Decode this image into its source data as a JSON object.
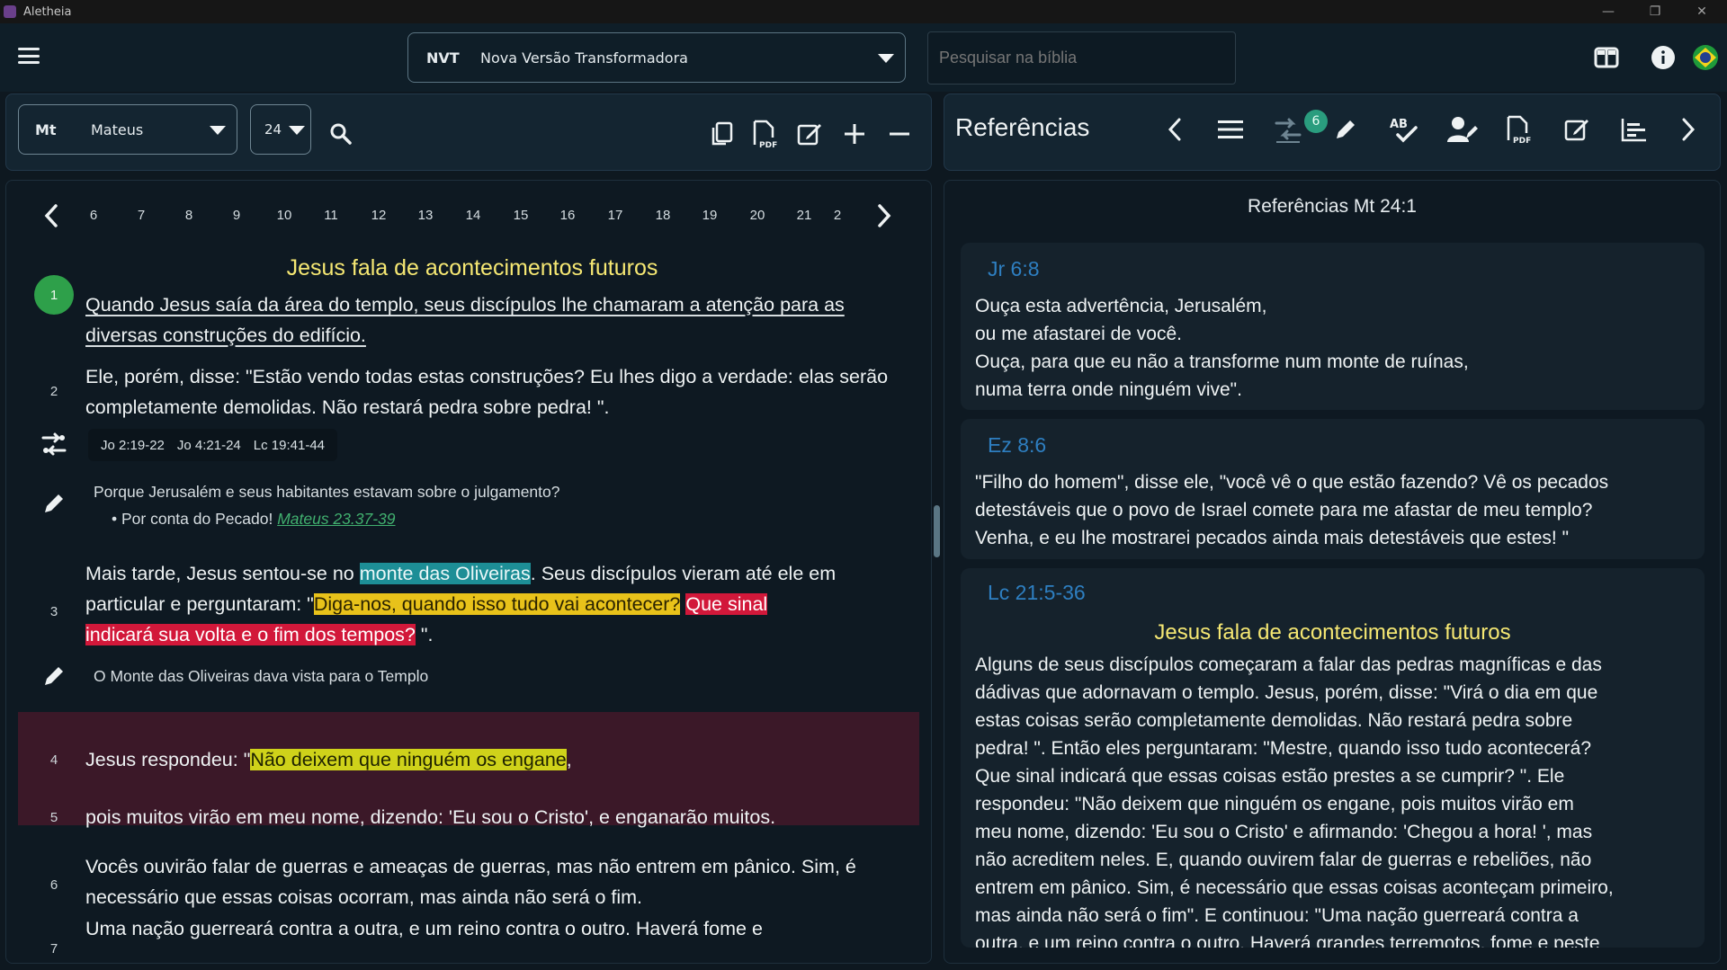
{
  "app": {
    "name": "Aletheia"
  },
  "window_controls": {
    "minimize": "—",
    "restore": "❐",
    "close": "✕"
  },
  "version": {
    "abbr": "NVT",
    "name": "Nova Versão Transformadora"
  },
  "search": {
    "placeholder": "Pesquisar na bíblia"
  },
  "book": {
    "abbr": "Mt",
    "name": "Mateus"
  },
  "chapter": {
    "value": "24"
  },
  "verse_nav": {
    "numbers": [
      "6",
      "7",
      "8",
      "9",
      "10",
      "11",
      "12",
      "13",
      "14",
      "15",
      "16",
      "17",
      "18",
      "19",
      "20",
      "21",
      "2"
    ]
  },
  "reading": {
    "section_title": "Jesus fala de acontecimentos futuros",
    "verses": [
      {
        "num": "1",
        "text": "Quando Jesus saía da área do templo, seus discípulos lhe chamaram a atenção para as diversas construções do edifício."
      },
      {
        "num": "2",
        "text": "Ele, porém, disse: \"Estão vendo todas estas construções? Eu lhes digo a verdade: elas serão completamente demolidas. Não restará pedra sobre pedra! \"."
      },
      {
        "num": "3",
        "pre": "Mais tarde, Jesus sentou-se no ",
        "hl1": "monte das Oliveiras",
        "mid": ". Seus discípulos vieram até ele em particular e perguntaram: \"",
        "hl2": "Diga-nos, quando isso tudo vai acontecer?",
        "sp": " ",
        "hl3a": "Que sinal",
        "hl3b": "indicará sua volta e o fim dos tempos?",
        "post": " \"."
      },
      {
        "num": "4",
        "pre": "Jesus respondeu: \"",
        "hl": "Não deixem que ninguém os engane",
        "post": ","
      },
      {
        "num": "5",
        "text": "pois muitos virão em meu nome, dizendo: 'Eu sou o Cristo', e enganarão muitos."
      },
      {
        "num": "6",
        "text": "Vocês ouvirão falar de guerras e ameaças de guerras, mas não entrem em pânico. Sim, é necessário que essas coisas ocorram, mas ainda não será o fim."
      },
      {
        "num": "7",
        "text": "Uma nação guerreará contra a outra, e um reino contra o outro. Haverá fome e"
      }
    ],
    "cross_refs": [
      "Jo 2:19-22",
      "Jo 4:21-24",
      "Lc 19:41-44"
    ],
    "note1": {
      "question": "Porque Jerusalém e seus habitantes estavam sobre o julgamento?",
      "bullet": "Por conta do Pecado!",
      "link": "Mateus 23.37-39"
    },
    "note2": {
      "text": "O Monte das Oliveiras dava vista para o Templo"
    }
  },
  "references": {
    "title": "Referências",
    "badge": "6",
    "subtitle": "Referências Mt 24:1",
    "cards": [
      {
        "name": "Jr 6:8",
        "lines": [
          "Ouça esta advertência, Jerusalém,",
          "ou me afastarei de você.",
          "Ouça, para que eu não a transforme num monte de ruínas,",
          "numa terra onde ninguém vive\"."
        ]
      },
      {
        "name": "Ez 8:6",
        "lines": [
          "\"Filho do homem\", disse ele, \"você vê o que estão fazendo? Vê os pecados",
          "detestáveis que o povo de Israel comete para me afastar de meu templo?",
          "Venha, e eu lhe mostrarei pecados ainda mais detestáveis que estes! \""
        ]
      },
      {
        "name": "Lc 21:5-36",
        "section": "Jesus fala de acontecimentos futuros",
        "lines": [
          "Alguns de seus discípulos começaram a falar das pedras magníficas e das",
          "dádivas que adornavam o templo. Jesus, porém, disse: \"Virá o dia em que",
          "estas coisas serão completamente demolidas. Não restará pedra sobre",
          "pedra! \". Então eles perguntaram: \"Mestre, quando isso tudo acontecerá?",
          "Que sinal indicará que essas coisas estão prestes a se cumprir? \". Ele",
          "respondeu: \"Não deixem que ninguém os engane, pois muitos virão em",
          "meu nome, dizendo: 'Eu sou o Cristo' e afirmando: 'Chegou a hora! ', mas",
          "não acreditem neles. E, quando ouvirem falar de guerras e rebeliões, não",
          "entrem em pânico. Sim, é necessário que essas coisas aconteçam primeiro,",
          "mas ainda não será o fim\". E continuou: \"Uma nação guerreará contra a",
          "outra, e um reino contra o outro. Haverá grandes terremotos, fome e peste"
        ]
      }
    ]
  },
  "colors": {
    "accent_green": "#2ea04a",
    "title_yellow": "#f6e873",
    "ref_blue": "#2e7fc1",
    "highlight_teal": "#1d8e96",
    "highlight_yellow": "#e8c21a",
    "highlight_red": "#d2183a",
    "highlight_lime": "#cfd21a"
  },
  "icons": [
    "menu-icon",
    "chevron-down-icon",
    "columns-icon",
    "info-icon",
    "brazil-flag-icon",
    "search-icon",
    "copy-icon",
    "pdf-icon",
    "edit-icon",
    "plus-icon",
    "minus-icon",
    "chevron-left-icon",
    "chevron-right-icon",
    "cross-reference-icon",
    "pencil-icon",
    "list-icon",
    "spellcheck-icon",
    "user-edit-icon",
    "chart-icon"
  ]
}
